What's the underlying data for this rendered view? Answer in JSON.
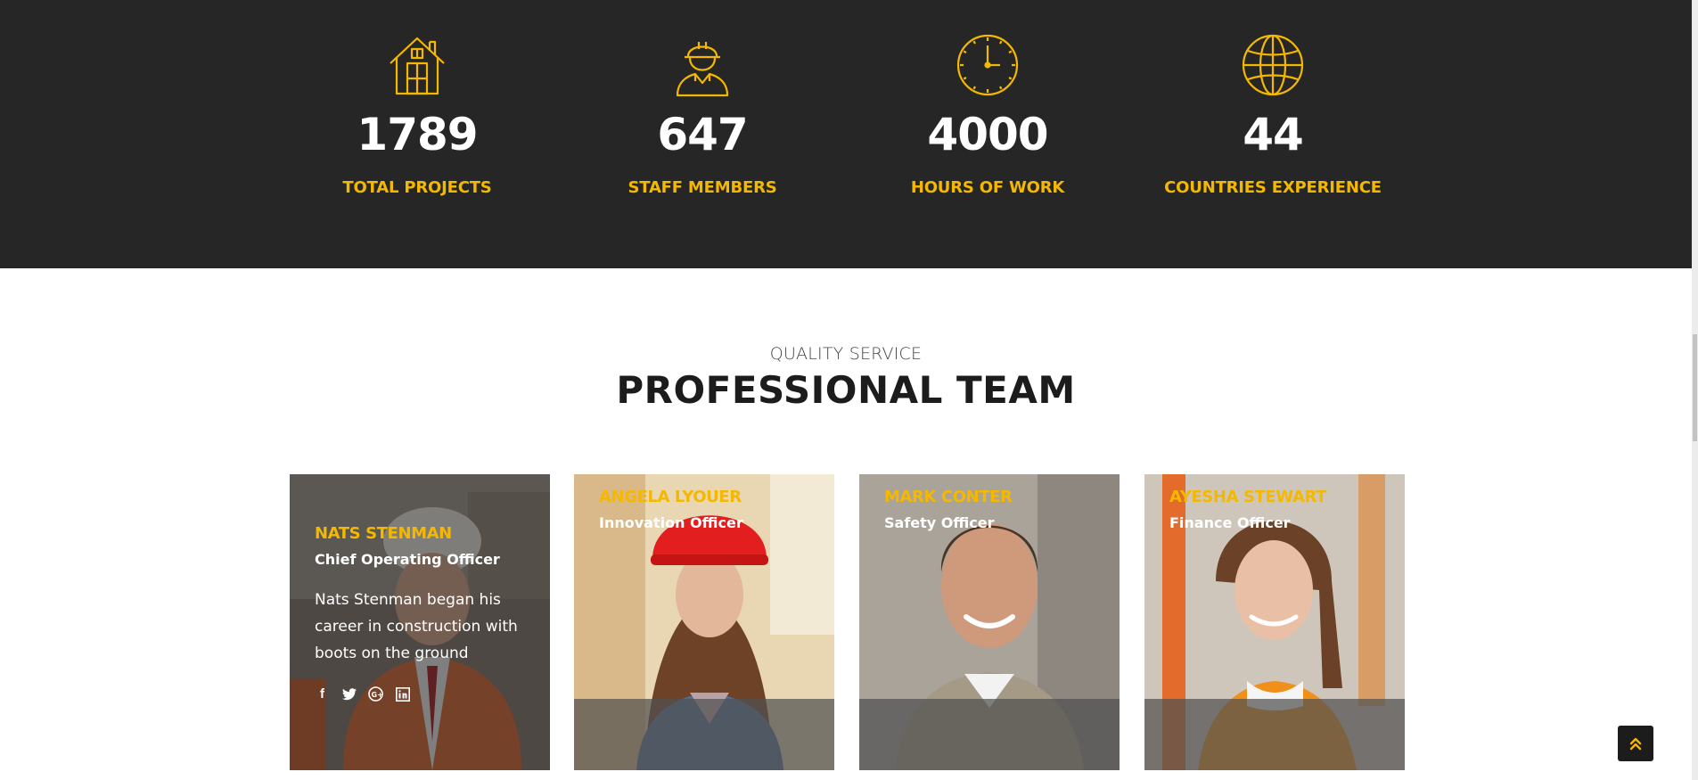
{
  "stats": [
    {
      "icon": "house-icon",
      "value": "1789",
      "label": "TOTAL PROJECTS"
    },
    {
      "icon": "worker-icon",
      "value": "647",
      "label": "STAFF MEMBERS"
    },
    {
      "icon": "clock-icon",
      "value": "4000",
      "label": "HOURS OF WORK"
    },
    {
      "icon": "globe-icon",
      "value": "44",
      "label": "COUNTRIES EXPERIENCE"
    }
  ],
  "section": {
    "subtitle": "QUALITY SERVICE",
    "title": "PROFESSIONAL TEAM"
  },
  "team": [
    {
      "name": "NATS STENMAN",
      "role": "Chief Operating Officer",
      "bio": "Nats Stenman began his career in construction with boots on the ground",
      "social": [
        "facebook-icon",
        "twitter-icon",
        "google-plus-icon",
        "linkedin-icon"
      ]
    },
    {
      "name": "ANGELA LYOUER",
      "role": "Innovation Officer"
    },
    {
      "name": "MARK CONTER",
      "role": "Safety Officer"
    },
    {
      "name": "AYESHA STEWART",
      "role": "Finance Officer"
    }
  ],
  "colors": {
    "accent": "#f5b800",
    "dark_band": "#262626",
    "heading": "#1c1c1c"
  }
}
